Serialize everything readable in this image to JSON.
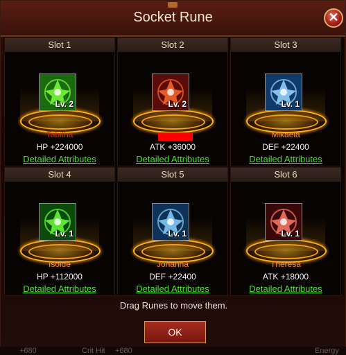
{
  "title": "Socket Rune",
  "slots": [
    {
      "header": "Slot 1",
      "level": "Lv. 2",
      "name": "Tabitha",
      "name_color": "#d22a1c",
      "stat": "HP +224000",
      "detail": "Detailed Attributes",
      "icon_bg": "#1c6a10",
      "icon_fg": "#7aff3a",
      "icon": "green-rune-icon"
    },
    {
      "header": "Slot 2",
      "level": "Lv. 2",
      "name": "",
      "name_color": "#ff0000",
      "stat": "ATK +36000",
      "detail": "Detailed Attributes",
      "icon_bg": "#5a0c08",
      "icon_fg": "#ff6a2a",
      "icon": "red-rune-icon"
    },
    {
      "header": "Slot 3",
      "level": "Lv. 1",
      "name": "Mikaela",
      "name_color": "#ff8a2a",
      "stat": "DEF +22400",
      "detail": "Detailed Attributes",
      "icon_bg": "#103a6a",
      "icon_fg": "#9ad8ff",
      "icon": "blue-rune-icon"
    },
    {
      "header": "Slot 4",
      "level": "Lv. 1",
      "name": "Isolde",
      "name_color": "#ff8a2a",
      "stat": "HP +112000",
      "detail": "Detailed Attributes",
      "icon_bg": "#0c4a0c",
      "icon_fg": "#6aff3a",
      "icon": "green-rune-icon"
    },
    {
      "header": "Slot 5",
      "level": "Lv. 1",
      "name": "Johanna",
      "name_color": "#ff8a2a",
      "stat": "DEF +22400",
      "detail": "Detailed Attributes",
      "icon_bg": "#0e3258",
      "icon_fg": "#8ad0ff",
      "icon": "blue-rune-icon"
    },
    {
      "header": "Slot 6",
      "level": "Lv. 1",
      "name": "Theresa",
      "name_color": "#ff8a2a",
      "stat": "ATK +18000",
      "detail": "Detailed Attributes",
      "icon_bg": "#3a0808",
      "icon_fg": "#ff7a6a",
      "icon": "red-rune-icon"
    }
  ],
  "hint": "Drag Runes to move them.",
  "ok_label": "OK",
  "close_glyph": "✕",
  "background_text": {
    "a": "+680",
    "b": "Crit Hit",
    "c": "+680",
    "d": "Energy"
  }
}
